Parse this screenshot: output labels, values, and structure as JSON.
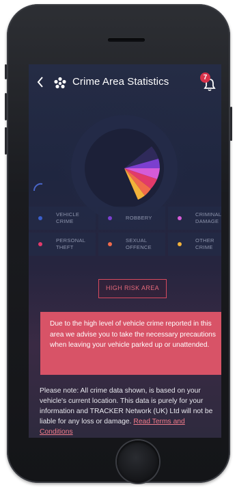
{
  "header": {
    "title": "Crime Area Statistics",
    "notification_count": "7"
  },
  "categories": [
    {
      "label": "VEHICLE CRIME",
      "color": "#3a5fcb"
    },
    {
      "label": "ROBBERY",
      "color": "#7b3fcf"
    },
    {
      "label": "CRIMINAL DAMAGE",
      "color": "#d55bd8"
    },
    {
      "label": "PERSONAL THEFT",
      "color": "#e23a6a"
    },
    {
      "label": "SEXUAL OFFENCE",
      "color": "#f06a4b"
    },
    {
      "label": "OTHER CRIME",
      "color": "#f2b23a"
    }
  ],
  "risk_label": "HIGH RISK AREA",
  "alert_text": "Due to the high level of vehicle crime reported in this area we advise you to take the necessary precautions when leaving your vehicle parked up or unattended.",
  "note": {
    "text": "Please note: All crime data shown, is based on your vehicle's current location. This data is purely for your information and TRACKER Network (UK) Ltd will not be liable for any loss or damage.",
    "link_label": "Read Terms and Conditions"
  },
  "colors": {
    "accent": "#d85367",
    "background": "#232a44"
  }
}
